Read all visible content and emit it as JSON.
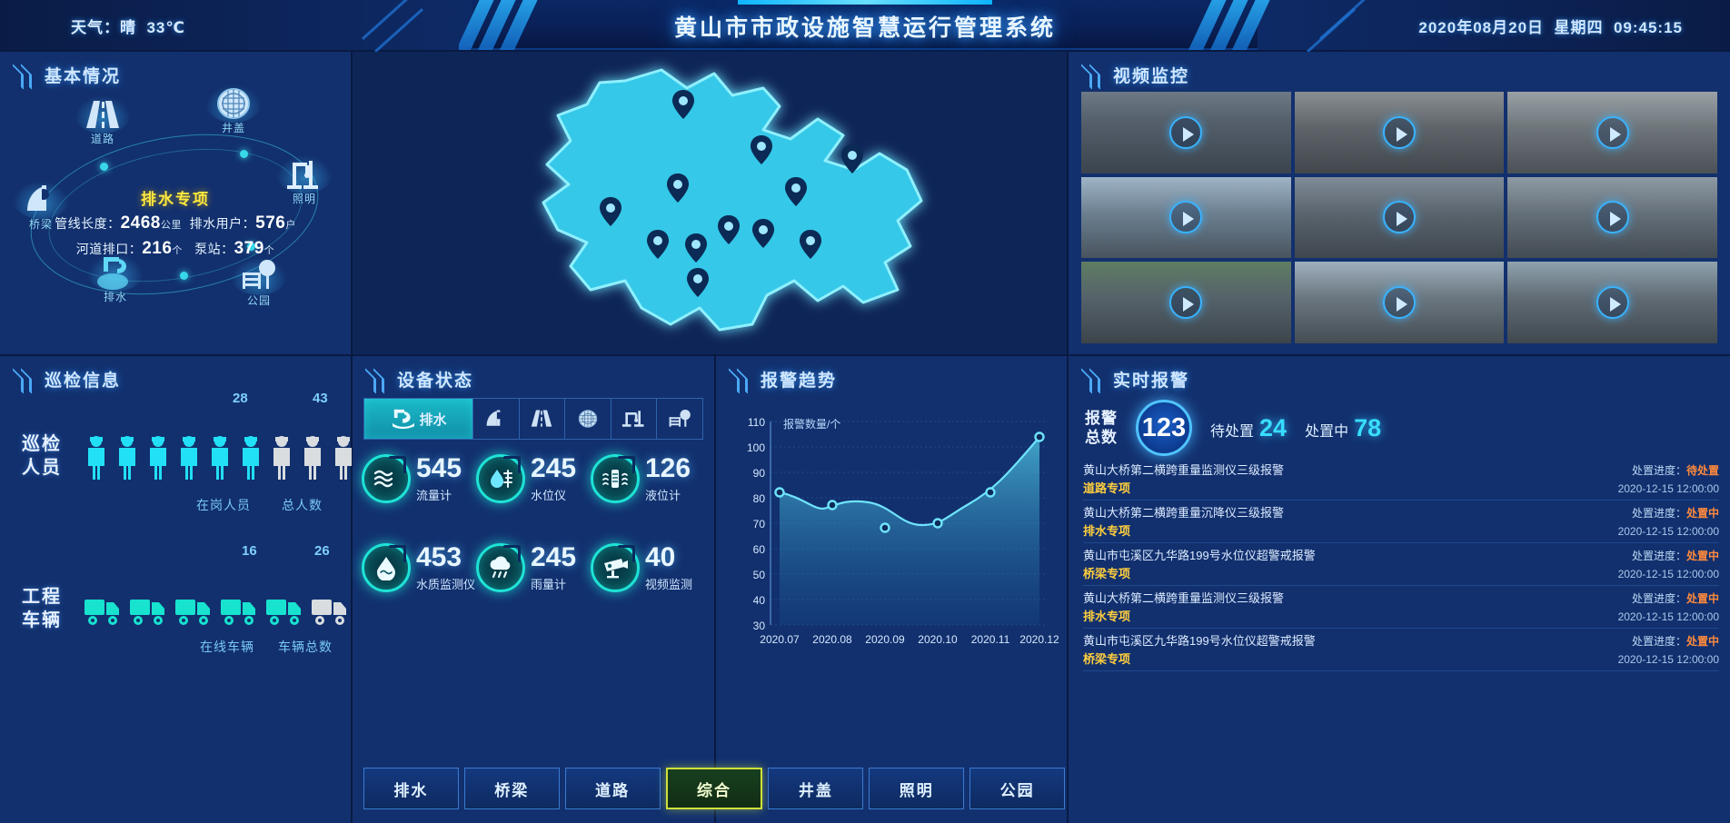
{
  "header": {
    "weather_label": "天气：",
    "weather_value": "晴",
    "temperature": "33℃",
    "title": "黄山市市政设施智慧运行管理系统",
    "date": "2020年08月20日",
    "weekday": "星期四",
    "time": "09:45:15"
  },
  "basic": {
    "title": "基本情况",
    "spec_title": "排水专项",
    "nodes": [
      {
        "label": "道路",
        "icon": "road-icon"
      },
      {
        "label": "井盖",
        "icon": "manhole-cover-icon"
      },
      {
        "label": "照明",
        "icon": "streetlight-icon"
      },
      {
        "label": "公园",
        "icon": "park-icon"
      },
      {
        "label": "排水",
        "icon": "drainage-icon"
      },
      {
        "label": "桥梁",
        "icon": "bridge-icon"
      }
    ],
    "stats": [
      {
        "label": "管线长度：",
        "value": "2468",
        "unit": "公里"
      },
      {
        "label": "排水用户：",
        "value": "576",
        "unit": "户"
      },
      {
        "label": "河道排口：",
        "value": "216",
        "unit": "个"
      },
      {
        "label": "泵站：",
        "value": "379",
        "unit": "个"
      }
    ]
  },
  "map": {
    "name": "huangshan-city-map",
    "marker_count": 12,
    "fill_color": "#35c8e8"
  },
  "video": {
    "title": "视频监控",
    "cells": [
      {
        "name": "camera-1"
      },
      {
        "name": "camera-2"
      },
      {
        "name": "camera-3"
      },
      {
        "name": "camera-4"
      },
      {
        "name": "camera-5"
      },
      {
        "name": "camera-6"
      },
      {
        "name": "camera-7"
      },
      {
        "name": "camera-8"
      },
      {
        "name": "camera-9"
      }
    ]
  },
  "inspection": {
    "title": "巡检信息",
    "rows": [
      {
        "name": "巡检\n人员",
        "name_l1": "巡检",
        "name_l2": "人员",
        "active_count": "28",
        "total_count": "43",
        "active_label": "在岗人员",
        "total_label": "总人数",
        "icon": "person-icon",
        "total_icons": 9,
        "active_icons": 6
      },
      {
        "name": "工程\n车辆",
        "name_l1": "工程",
        "name_l2": "车辆",
        "active_count": "16",
        "total_count": "26",
        "active_label": "在线车辆",
        "total_label": "车辆总数",
        "icon": "truck-icon",
        "total_icons": 7,
        "active_icons": 5
      }
    ]
  },
  "device": {
    "title": "设备状态",
    "tabs": [
      {
        "label": "排水",
        "icon": "faucet-icon",
        "active": true
      },
      {
        "label": "",
        "icon": "bridge-icon",
        "active": false
      },
      {
        "label": "",
        "icon": "road-icon",
        "active": false
      },
      {
        "label": "",
        "icon": "manhole-cover-icon",
        "active": false
      },
      {
        "label": "",
        "icon": "streetlight-icon",
        "active": false
      },
      {
        "label": "",
        "icon": "park-icon",
        "active": false
      }
    ],
    "items": [
      {
        "value": "545",
        "label": "流量计",
        "icon": "flow-meter-icon"
      },
      {
        "value": "245",
        "label": "水位仪",
        "icon": "water-level-icon"
      },
      {
        "value": "126",
        "label": "液位计",
        "icon": "liquid-level-icon"
      },
      {
        "value": "453",
        "label": "水质监测仪",
        "icon": "water-quality-icon"
      },
      {
        "value": "245",
        "label": "雨量计",
        "icon": "rain-gauge-icon"
      },
      {
        "value": "40",
        "label": "视频监测",
        "icon": "video-monitor-icon"
      }
    ]
  },
  "trend": {
    "title": "报警趋势"
  },
  "chart_data": {
    "type": "area",
    "title": "报警趋势",
    "ylabel": "报警数量/个",
    "xlabel": "",
    "categories": [
      "2020.07",
      "2020.08",
      "2020.09",
      "2020.10",
      "2020.11",
      "2020.12"
    ],
    "values": [
      82,
      77,
      68,
      70,
      82,
      101
    ],
    "yticks": [
      30,
      40,
      50,
      60,
      70,
      80,
      90,
      100,
      110
    ],
    "ylim": [
      30,
      110
    ],
    "grid": true,
    "line_color": "#3fc5e0",
    "fill_color": "#2b7fb8",
    "point_color": "#6fe4ff",
    "legend": []
  },
  "realtime": {
    "title": "实时报警",
    "total_label_l1": "报警",
    "total_label_l2": "总数",
    "total_value": "123",
    "pending_label": "待处置",
    "pending_value": "24",
    "processing_label": "处置中",
    "processing_value": "78",
    "progress_label": "处置进度：",
    "items": [
      {
        "message": "黄山大桥第二横跨重量监测仪三级报警",
        "progress_label": "处置进度：",
        "progress": "待处置",
        "progress_color": "#ff8a3d",
        "category": "道路专项",
        "time": "2020-12-15 12:00:00"
      },
      {
        "message": "黄山大桥第二横跨重量沉降仪三级报警",
        "progress_label": "处置进度：",
        "progress": "处置中",
        "progress_color": "#ff8a3d",
        "category": "排水专项",
        "time": "2020-12-15 12:00:00"
      },
      {
        "message": "黄山市屯溪区九华路199号水位仪超警戒报警",
        "progress_label": "处置进度：",
        "progress": "处置中",
        "progress_color": "#ff8a3d",
        "category": "桥梁专项",
        "time": "2020-12-15 12:00:00"
      },
      {
        "message": "黄山大桥第二横跨重量监测仪三级报警",
        "progress_label": "处置进度：",
        "progress": "处置中",
        "progress_color": "#ff8a3d",
        "category": "排水专项",
        "time": "2020-12-15 12:00:00"
      },
      {
        "message": "黄山市屯溪区九华路199号水位仪超警戒报警",
        "progress_label": "处置进度：",
        "progress": "处置中",
        "progress_color": "#ff8a3d",
        "category": "桥梁专项",
        "time": "2020-12-15 12:00:00"
      }
    ]
  },
  "bottom_tabs": [
    {
      "label": "排水",
      "active": false
    },
    {
      "label": "桥梁",
      "active": false
    },
    {
      "label": "道路",
      "active": false
    },
    {
      "label": "综合",
      "active": true
    },
    {
      "label": "井盖",
      "active": false
    },
    {
      "label": "照明",
      "active": false
    },
    {
      "label": "公园",
      "active": false
    }
  ],
  "colors": {
    "accent_cyan": "#38ddff",
    "accent_yellow": "#ffe93d",
    "panel_bg": "#12306e",
    "map_fill": "#35c8e8"
  }
}
